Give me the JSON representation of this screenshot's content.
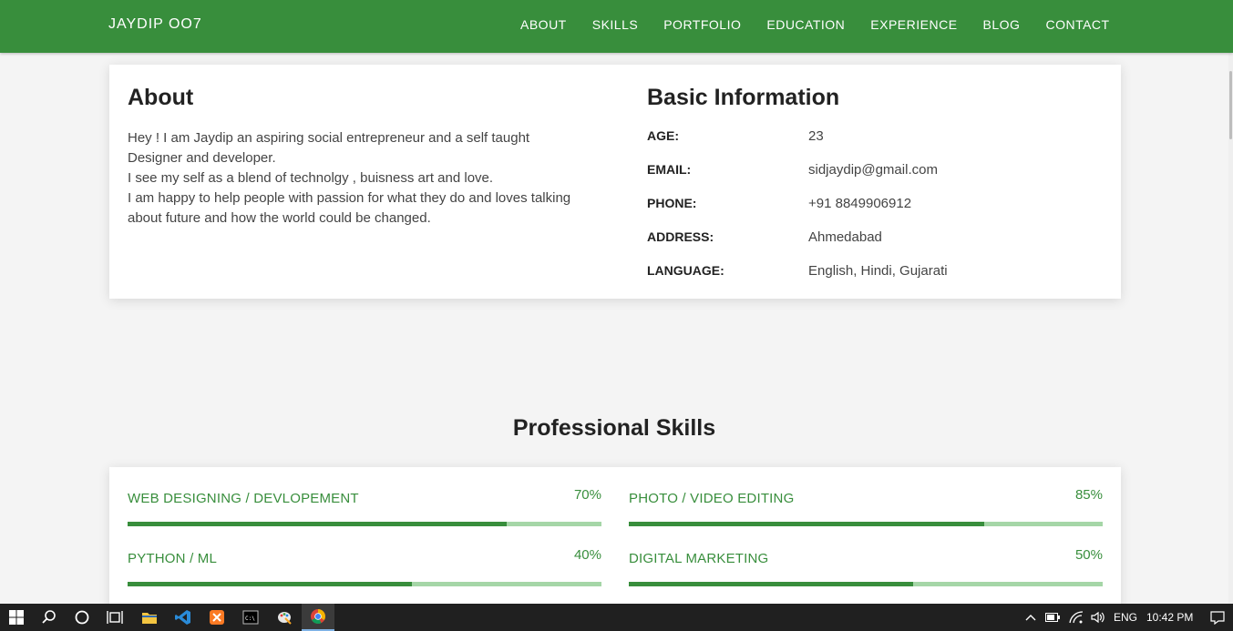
{
  "nav": {
    "brand": "JAYDIP OO7",
    "items": [
      "ABOUT",
      "SKILLS",
      "PORTFOLIO",
      "EDUCATION",
      "EXPERIENCE",
      "BLOG",
      "CONTACT"
    ]
  },
  "about": {
    "title": "About",
    "paragraphs": [
      "Hey ! I am Jaydip an aspiring social entrepreneur and a self taught Designer and developer.",
      "I see my self as a blend of technolgy , buisness art and love.",
      "I am happy to help people with passion for what they do and loves talking about future and how the world could be changed."
    ]
  },
  "basic_info": {
    "title": "Basic Information",
    "rows": [
      {
        "label": "AGE:",
        "value": "23"
      },
      {
        "label": "EMAIL:",
        "value": "sidjaydip@gmail.com"
      },
      {
        "label": "PHONE:",
        "value": "+91 8849906912"
      },
      {
        "label": "ADDRESS:",
        "value": "Ahmedabad"
      },
      {
        "label": "LANGUAGE:",
        "value": "English, Hindi, Gujarati"
      }
    ]
  },
  "skills": {
    "title": "Professional Skills",
    "items": [
      {
        "name": "WEB DESIGNING / DEVLOPEMENT",
        "percent_label": "70%",
        "fill_fraction": 0.8
      },
      {
        "name": "PHOTO / VIDEO EDITING",
        "percent_label": "85%",
        "fill_fraction": 0.75
      },
      {
        "name": "PYTHON / ML",
        "percent_label": "40%",
        "fill_fraction": 0.6
      },
      {
        "name": "DIGITAL MARKETING",
        "percent_label": "50%",
        "fill_fraction": 0.6
      }
    ]
  },
  "colors": {
    "brand_green": "#388e3c",
    "bar_track": "#a5d6a7"
  },
  "taskbar": {
    "icons": [
      "windows-start-icon",
      "search-icon",
      "cortana-icon",
      "task-view-icon",
      "file-explorer-icon",
      "vscode-icon",
      "xampp-icon",
      "terminal-icon",
      "paint-icon",
      "chrome-icon"
    ],
    "tray": {
      "language": "ENG",
      "time": "10:42 PM"
    }
  }
}
